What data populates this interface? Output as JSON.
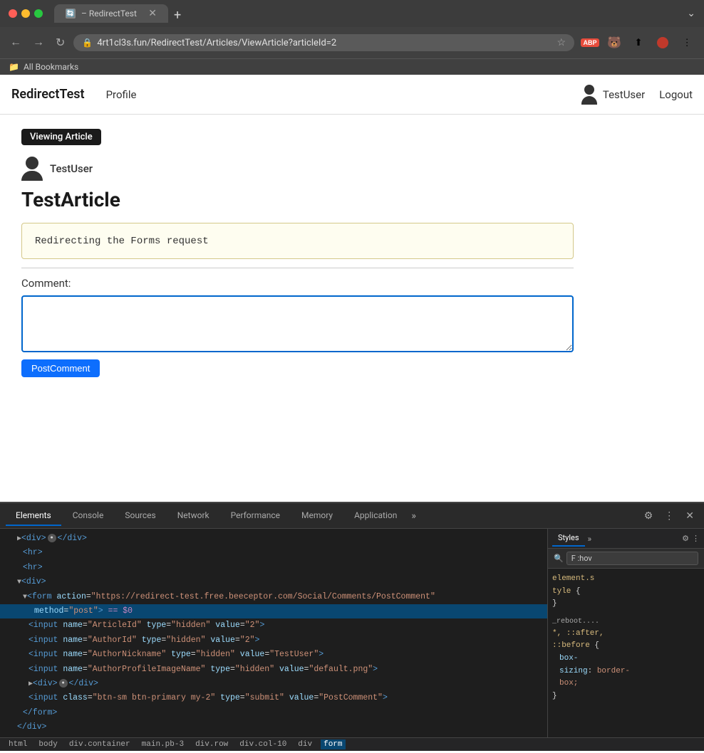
{
  "browser": {
    "tab_title": "– RedirectTest",
    "tab_favicon": "🔄",
    "url": "4rt1cl3s.fun/RedirectTest/Articles/ViewArticle?articleId=2",
    "bookmarks_bar_label": "All Bookmarks",
    "new_tab_tooltip": "New tab"
  },
  "navbar": {
    "brand": "RedirectTest",
    "profile_link": "Profile",
    "username": "TestUser",
    "logout_label": "Logout"
  },
  "page": {
    "badge_label": "Viewing Article",
    "author": "TestUser",
    "article_title": "TestArticle",
    "article_body": "Redirecting the Forms request",
    "comment_label": "Comment:",
    "comment_placeholder": "",
    "post_comment_btn": "PostComment"
  },
  "devtools": {
    "tabs": [
      "Elements",
      "Console",
      "Sources",
      "Network",
      "Performance",
      "Memory",
      "Application"
    ],
    "tabs_more": "»",
    "active_tab": "Elements",
    "styles_panel": {
      "tabs": [
        "Styles",
        "»"
      ],
      "filter_placeholder": "F :hov",
      "filter_icon": "🔍",
      "element_style_label": "element.s\ntyle {",
      "element_style_close": "}",
      "reboot_label": "_reboot....",
      "reboot_selectors": "*, ::after,\n::before {",
      "properties": [
        {
          "name": "box-\nsizing",
          "value": "border-\nbox;"
        }
      ]
    },
    "html_lines": [
      {
        "indent": 4,
        "content": "▶<div>⬤ </div>"
      },
      {
        "indent": 6,
        "content": "<hr>"
      },
      {
        "indent": 6,
        "content": "<hr>"
      },
      {
        "indent": 4,
        "content": "▼<div>"
      },
      {
        "indent": 6,
        "content": "▼<form action=\"https://redirect-test.free.beeceptor.com/Social/Comments/PostComment\""
      },
      {
        "indent": 10,
        "content": "method=\"post\"> == $0"
      },
      {
        "indent": 8,
        "content": "<input name=\"ArticleId\" type=\"hidden\" value=\"2\">"
      },
      {
        "indent": 8,
        "content": "<input name=\"AuthorId\" type=\"hidden\" value=\"2\">"
      },
      {
        "indent": 8,
        "content": "<input name=\"AuthorNickname\" type=\"hidden\" value=\"TestUser\">"
      },
      {
        "indent": 8,
        "content": "<input name=\"AuthorProfileImageName\" type=\"hidden\" value=\"default.png\">"
      },
      {
        "indent": 8,
        "content": "▶<div>⬤ </div>"
      },
      {
        "indent": 8,
        "content": "<input class=\"btn-sm btn-primary my-2\" type=\"submit\" value=\"PostComment\">"
      },
      {
        "indent": 6,
        "content": "</form>"
      },
      {
        "indent": 4,
        "content": "</div>"
      }
    ],
    "statusbar": [
      "html",
      "body",
      "div.container",
      "main.pb-3",
      "div.row",
      "div.col-10",
      "div",
      "form"
    ],
    "active_statusbar": "form"
  }
}
